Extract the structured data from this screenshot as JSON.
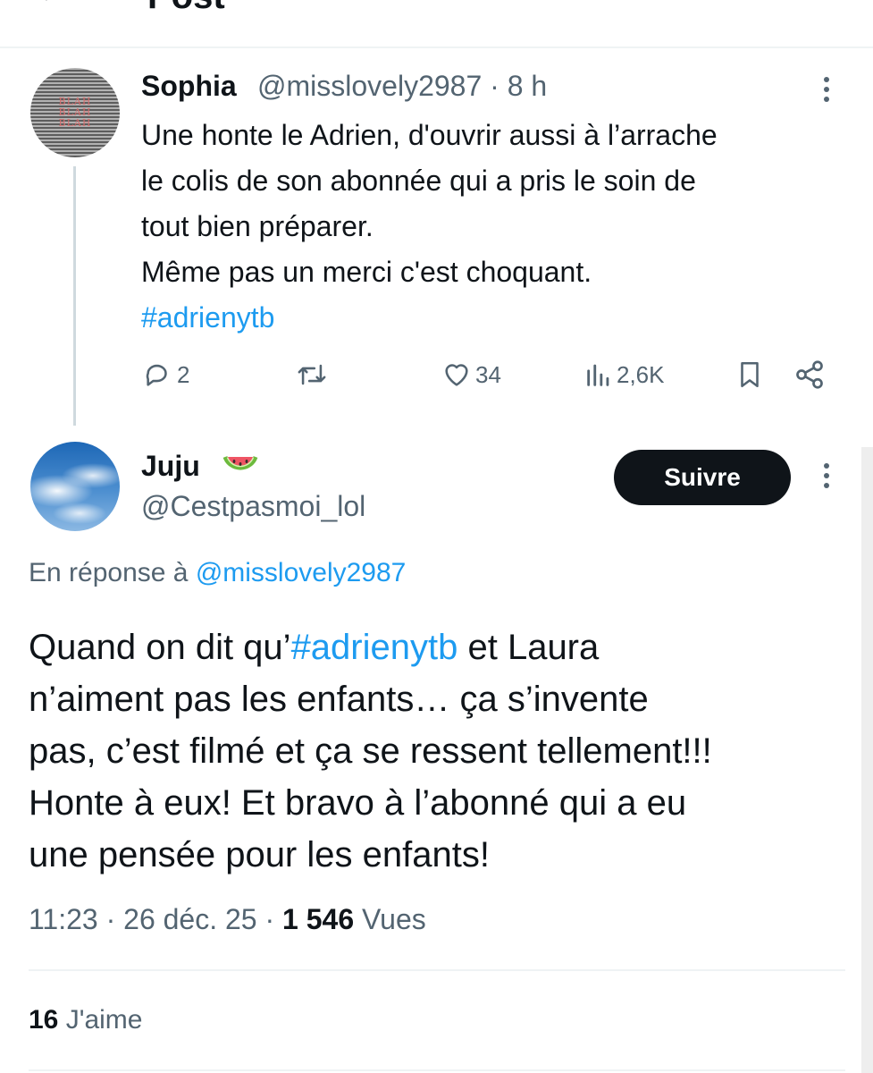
{
  "header": {
    "back_glyph": "←",
    "title": "Post"
  },
  "parent_tweet": {
    "author_name": "Sophia",
    "handle": "@misslovely2987",
    "time": "8 h",
    "avatar_text": [
      "BLAH",
      "BLAH",
      "BLAH"
    ],
    "text_lines": [
      "Une honte le Adrien, d'ouvrir aussi à  l’arrache",
      "le colis de son abonnée qui a pris le soin de",
      "tout bien préparer.",
      "Même pas un merci c'est choquant."
    ],
    "hashtag": "#adrienytb",
    "replies": "2",
    "likes": "34",
    "views": "2,6K"
  },
  "main_tweet": {
    "author_name": "Juju",
    "emoji_icon": "watermelon-icon",
    "handle": "@Cestpasmoi_lol",
    "follow_label": "Suivre",
    "reply_prefix": "En réponse à",
    "reply_mention": "@misslovely2987",
    "line1_before": "Quand on dit qu’",
    "line1_hashtag": "#adrienytb",
    "line1_after": " et Laura",
    "lines": [
      "n’aiment pas les enfants… ça s’invente",
      "pas, c’est filmé et ça se ressent tellement!!!",
      "Honte à eux! Et bravo à l’abonné qui a eu",
      "une pensée pour les enfants!"
    ],
    "time": "11:23",
    "date": "26 déc. 25",
    "views_count": "1 546",
    "views_label": "Vues",
    "likes_count": "16",
    "likes_label": "J'aime"
  },
  "colors": {
    "accent": "#1d9bf0",
    "text": "#0f1419",
    "secondary": "#536471",
    "divider": "#eff3f4"
  }
}
